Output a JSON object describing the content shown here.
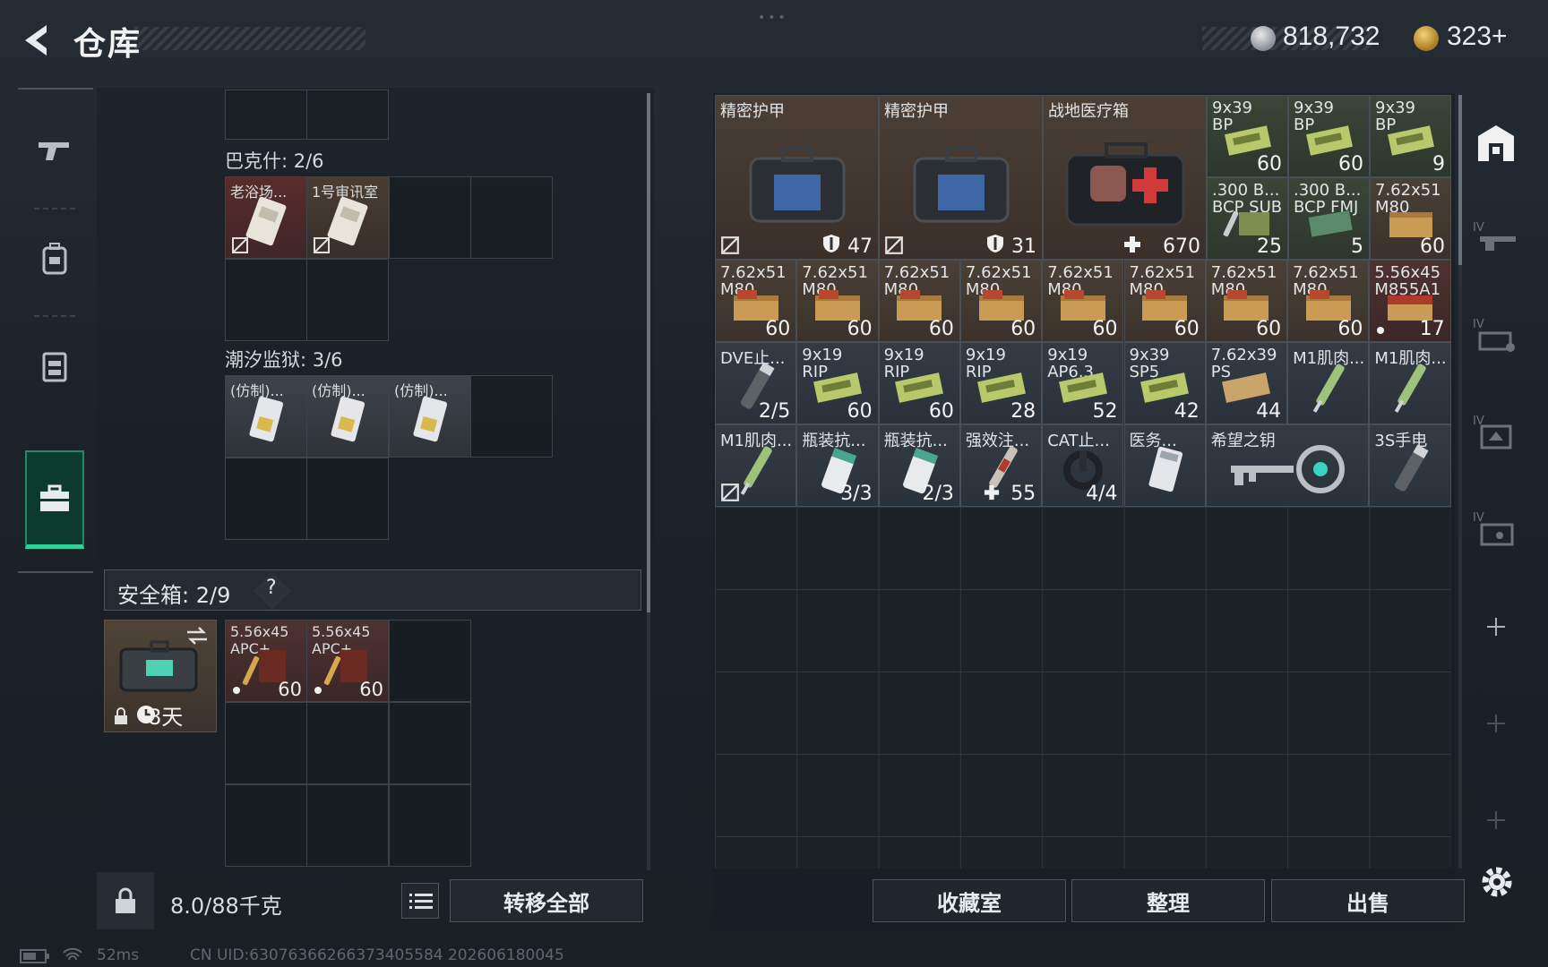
{
  "header": {
    "title": "仓库",
    "currency1": "818,732",
    "currency2": "323+"
  },
  "left": {
    "groups": [
      {
        "title": "巴克什: 2/6",
        "items": [
          "老浴场...",
          "1号审讯室"
        ]
      },
      {
        "title": "潮汐监狱: 3/6",
        "items": [
          "(仿制)...",
          "(仿制)...",
          "(仿制)..."
        ]
      }
    ],
    "safe": {
      "label": "安全箱: 2/9",
      "help": "?",
      "days": "8天",
      "items": [
        {
          "name": "5.56x45",
          "name2": "APC+",
          "count": "60"
        },
        {
          "name": "5.56x45",
          "name2": "APC+",
          "count": "60"
        }
      ]
    },
    "weight": "8.0/88千克",
    "transfer_label": "转移全部"
  },
  "warehouse": {
    "big": [
      {
        "name": "精密护甲",
        "count": "47"
      },
      {
        "name": "精密护甲",
        "count": "31"
      },
      {
        "name": "战地医疗箱",
        "count": "670"
      }
    ],
    "small": [
      {
        "name": "9x39",
        "name2": "BP",
        "count": "60",
        "type": "green"
      },
      {
        "name": "9x39",
        "name2": "BP",
        "count": "60",
        "type": "green"
      },
      {
        "name": "9x39",
        "name2": "BP",
        "count": "9",
        "type": "green"
      },
      {
        "name": ".300 B...",
        "name2": "BCP SUB",
        "count": "25",
        "type": "green"
      },
      {
        "name": ".300 B...",
        "name2": "BCP FMJ",
        "count": "5",
        "type": "green"
      },
      {
        "name": "7.62x51",
        "name2": "M80",
        "count": "60",
        "type": "ammo"
      }
    ],
    "row2": [
      {
        "name": "7.62x51",
        "name2": "M80",
        "count": "60"
      },
      {
        "name": "7.62x51",
        "name2": "M80",
        "count": "60"
      },
      {
        "name": "7.62x51",
        "name2": "M80",
        "count": "60"
      },
      {
        "name": "7.62x51",
        "name2": "M80",
        "count": "60"
      },
      {
        "name": "7.62x51",
        "name2": "M80",
        "count": "60"
      },
      {
        "name": "7.62x51",
        "name2": "M80",
        "count": "60"
      },
      {
        "name": "7.62x51",
        "name2": "M80",
        "count": "60"
      },
      {
        "name": "7.62x51",
        "name2": "M80",
        "count": "60"
      },
      {
        "name": "5.56x45",
        "name2": "M855A1",
        "count": "17"
      }
    ],
    "row3": [
      {
        "name": "DVE止...",
        "name2": "",
        "count": "2/5"
      },
      {
        "name": "9x19",
        "name2": "RIP",
        "count": "60"
      },
      {
        "name": "9x19",
        "name2": "RIP",
        "count": "60"
      },
      {
        "name": "9x19",
        "name2": "RIP",
        "count": "28"
      },
      {
        "name": "9x19",
        "name2": "AP6.3",
        "count": "52"
      },
      {
        "name": "9x39",
        "name2": "SP5",
        "count": "42"
      },
      {
        "name": "7.62x39",
        "name2": "PS",
        "count": "44"
      },
      {
        "name": "M1肌肉...",
        "name2": "",
        "count": ""
      },
      {
        "name": "M1肌肉...",
        "name2": "",
        "count": ""
      }
    ],
    "row4": [
      {
        "name": "M1肌肉...",
        "count": ""
      },
      {
        "name": "瓶装抗...",
        "count": "3/3"
      },
      {
        "name": "瓶装抗...",
        "count": "2/3"
      },
      {
        "name": "强效注...",
        "count": "55"
      },
      {
        "name": "CAT止...",
        "count": "4/4"
      },
      {
        "name": "医务...",
        "count": ""
      },
      {
        "name": "希望之钥",
        "count": ""
      },
      {
        "name": "3S手电",
        "count": ""
      }
    ],
    "buttons": {
      "collect": "收藏室",
      "sort": "整理",
      "sell": "出售"
    }
  },
  "status": {
    "ping": "52ms",
    "uid": "CN UID:630763662663734055​84 202606180045"
  },
  "colors": {
    "accent": "#2fd39a",
    "active_bg": "#0d3a2e"
  }
}
